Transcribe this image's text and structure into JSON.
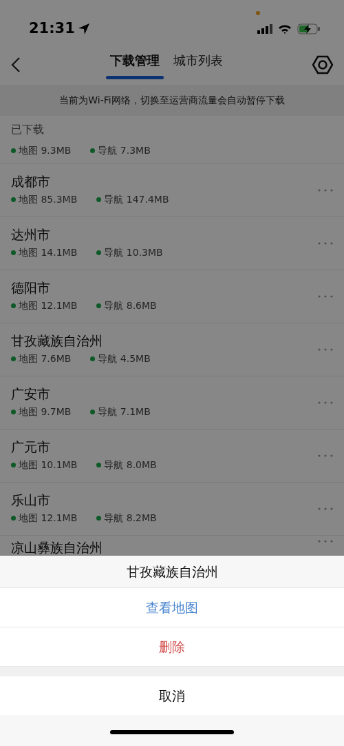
{
  "status_bar": {
    "time": "21:31"
  },
  "nav": {
    "tabs": [
      {
        "label": "下载管理",
        "selected": true
      },
      {
        "label": "城市列表",
        "selected": false
      }
    ]
  },
  "notice": "当前为Wi-Fi网络，切换至运营商流量会自动暂停下载",
  "section": {
    "title": "已下载"
  },
  "cities": [
    {
      "map": "地图 9.3MB",
      "nav": "导航 7.3MB"
    },
    {
      "name": "成都市",
      "map": "地图 85.3MB",
      "nav": "导航 147.4MB"
    },
    {
      "name": "达州市",
      "map": "地图 14.1MB",
      "nav": "导航 10.3MB"
    },
    {
      "name": "德阳市",
      "map": "地图 12.1MB",
      "nav": "导航 8.6MB"
    },
    {
      "name": "甘孜藏族自治州",
      "map": "地图 7.6MB",
      "nav": "导航 4.5MB"
    },
    {
      "name": "广安市",
      "map": "地图 9.7MB",
      "nav": "导航 7.1MB"
    },
    {
      "name": "广元市",
      "map": "地图 10.1MB",
      "nav": "导航 8.0MB"
    },
    {
      "name": "乐山市",
      "map": "地图 12.1MB",
      "nav": "导航 8.2MB"
    },
    {
      "name": "凉山彝族自治州"
    }
  ],
  "action_sheet": {
    "title": "甘孜藏族自治州",
    "actions": [
      {
        "label": "查看地图",
        "kind": "default"
      },
      {
        "label": "删除",
        "kind": "destructive"
      }
    ],
    "cancel": "取消"
  }
}
